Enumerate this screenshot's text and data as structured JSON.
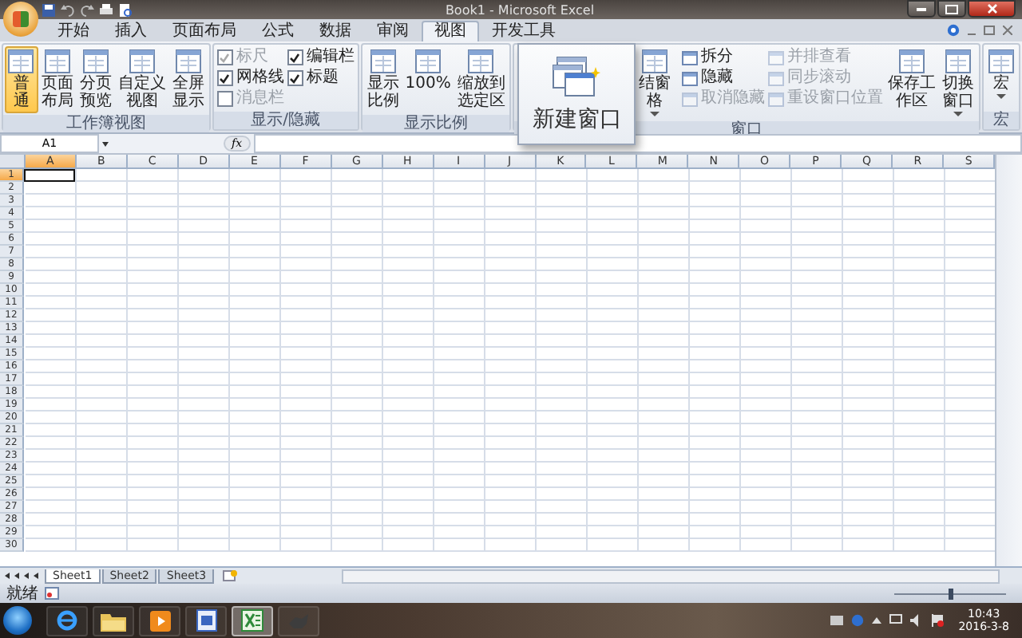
{
  "window": {
    "title": "Book1 - Microsoft Excel"
  },
  "ribbon_tabs": [
    {
      "label": "开始",
      "selected": false
    },
    {
      "label": "插入",
      "selected": false
    },
    {
      "label": "页面布局",
      "selected": false
    },
    {
      "label": "公式",
      "selected": false
    },
    {
      "label": "数据",
      "selected": false
    },
    {
      "label": "审阅",
      "selected": false
    },
    {
      "label": "视图",
      "selected": true
    },
    {
      "label": "开发工具",
      "selected": false
    }
  ],
  "ribbon_groups": [
    {
      "label": "工作簿视图",
      "items": [
        {
          "kind": "large",
          "label": "普通",
          "selected": true
        },
        {
          "kind": "large",
          "label": "页面布局",
          "selected": false
        },
        {
          "kind": "large",
          "label": "分页预览",
          "selected": false
        },
        {
          "kind": "large",
          "label": "自定义视图",
          "selected": false
        },
        {
          "kind": "large",
          "label": "全屏显示",
          "selected": false
        }
      ]
    },
    {
      "label": "显示/隐藏",
      "items": [
        {
          "kind": "check",
          "label": "标尺",
          "checked": true,
          "disabled": true
        },
        {
          "kind": "check",
          "label": "网格线",
          "checked": true,
          "disabled": false
        },
        {
          "kind": "check",
          "label": "消息栏",
          "checked": false,
          "disabled": true
        },
        {
          "kind": "check",
          "label": "编辑栏",
          "checked": true,
          "disabled": false
        },
        {
          "kind": "check",
          "label": "标题",
          "checked": true,
          "disabled": false
        }
      ]
    },
    {
      "label": "显示比例",
      "items": [
        {
          "kind": "large",
          "label": "显示比例"
        },
        {
          "kind": "large",
          "label": "100%"
        },
        {
          "kind": "large",
          "label": "缩放到选定区"
        }
      ]
    },
    {
      "label": "窗口",
      "popup": {
        "label": "新建窗口"
      },
      "items": [
        {
          "kind": "large",
          "label": "结窗格",
          "dropdown": true
        },
        {
          "kind": "small",
          "label": "拆分",
          "disabled": false
        },
        {
          "kind": "small",
          "label": "隐藏",
          "disabled": false
        },
        {
          "kind": "small",
          "label": "取消隐藏",
          "disabled": true
        },
        {
          "kind": "small",
          "label": "并排查看",
          "disabled": true
        },
        {
          "kind": "small",
          "label": "同步滚动",
          "disabled": true
        },
        {
          "kind": "small",
          "label": "重设窗口位置",
          "disabled": true
        },
        {
          "kind": "large",
          "label": "保存工作区"
        },
        {
          "kind": "large",
          "label": "切换窗口",
          "dropdown": true
        }
      ]
    },
    {
      "label": "宏",
      "items": [
        {
          "kind": "large",
          "label": "宏",
          "dropdown": true
        }
      ]
    }
  ],
  "formula_bar": {
    "name_box": "A1",
    "function_button": "fx"
  },
  "columns": [
    {
      "label": "A",
      "selected": true
    },
    {
      "label": "B",
      "selected": false
    },
    {
      "label": "C",
      "selected": false
    },
    {
      "label": "D",
      "selected": false
    },
    {
      "label": "E",
      "selected": false
    },
    {
      "label": "F",
      "selected": false
    },
    {
      "label": "G",
      "selected": false
    },
    {
      "label": "H",
      "selected": false
    },
    {
      "label": "I",
      "selected": false
    },
    {
      "label": "J",
      "selected": false
    },
    {
      "label": "K",
      "selected": false
    },
    {
      "label": "L",
      "selected": false
    },
    {
      "label": "M",
      "selected": false
    },
    {
      "label": "N",
      "selected": false
    },
    {
      "label": "O",
      "selected": false
    },
    {
      "label": "P",
      "selected": false
    },
    {
      "label": "Q",
      "selected": false
    },
    {
      "label": "R",
      "selected": false
    },
    {
      "label": "S",
      "selected": false
    }
  ],
  "rows": [
    {
      "label": "1",
      "selected": true
    },
    {
      "label": "2",
      "selected": false
    },
    {
      "label": "3",
      "selected": false
    },
    {
      "label": "4",
      "selected": false
    },
    {
      "label": "5",
      "selected": false
    },
    {
      "label": "6",
      "selected": false
    },
    {
      "label": "7",
      "selected": false
    },
    {
      "label": "8",
      "selected": false
    },
    {
      "label": "9",
      "selected": false
    },
    {
      "label": "10",
      "selected": false
    },
    {
      "label": "11",
      "selected": false
    },
    {
      "label": "12",
      "selected": false
    },
    {
      "label": "13",
      "selected": false
    },
    {
      "label": "14",
      "selected": false
    },
    {
      "label": "15",
      "selected": false
    },
    {
      "label": "16",
      "selected": false
    },
    {
      "label": "17",
      "selected": false
    },
    {
      "label": "18",
      "selected": false
    },
    {
      "label": "19",
      "selected": false
    },
    {
      "label": "20",
      "selected": false
    },
    {
      "label": "21",
      "selected": false
    },
    {
      "label": "22",
      "selected": false
    },
    {
      "label": "23",
      "selected": false
    },
    {
      "label": "24",
      "selected": false
    },
    {
      "label": "25",
      "selected": false
    },
    {
      "label": "26",
      "selected": false
    },
    {
      "label": "27",
      "selected": false
    },
    {
      "label": "28",
      "selected": false
    },
    {
      "label": "29",
      "selected": false
    },
    {
      "label": "30",
      "selected": false
    }
  ],
  "sheet_tabs": [
    {
      "label": "Sheet1",
      "selected": true
    },
    {
      "label": "Sheet2",
      "selected": false
    },
    {
      "label": "Sheet3",
      "selected": false
    }
  ],
  "status_bar": {
    "text": "就绪",
    "zoom": {
      "level": 0.5
    }
  },
  "taskbar": {
    "apps": [
      {
        "kind": "browser",
        "active": false
      },
      {
        "kind": "folder",
        "active": false
      },
      {
        "kind": "media",
        "active": false
      },
      {
        "kind": "document",
        "active": false
      },
      {
        "kind": "spreadsheet",
        "active": true
      },
      {
        "kind": "tool",
        "active": false
      }
    ],
    "time": "10:43",
    "date": "2016-3-8"
  }
}
